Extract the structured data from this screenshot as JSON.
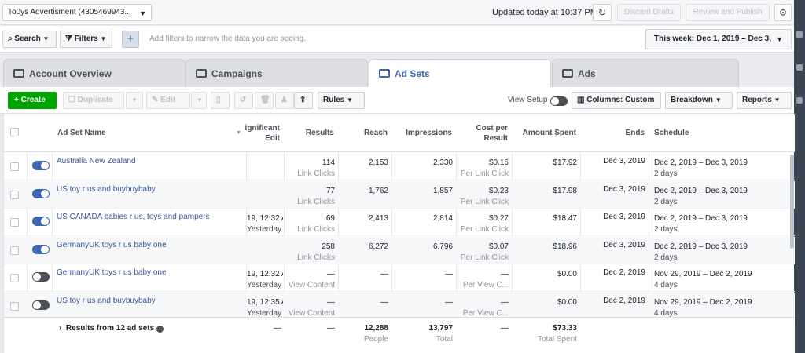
{
  "topbar": {
    "account": "To0ys Advertisment (4305469943...",
    "updated": "Updated today at 10:37 PM",
    "discard": "Discard Drafts",
    "review": "Review and Publish"
  },
  "filterbar": {
    "search": "Search",
    "filters": "Filters",
    "hint": "Add filters to narrow the data you are seeing.",
    "date": "This week: Dec 1, 2019 – Dec 3,"
  },
  "tabs": [
    {
      "label": "Account Overview"
    },
    {
      "label": "Campaigns"
    },
    {
      "label": "Ad Sets"
    },
    {
      "label": "Ads"
    }
  ],
  "toolbar": {
    "create": "Create",
    "duplicate": "Duplicate",
    "edit": "Edit",
    "rules": "Rules",
    "view_setup": "View Setup",
    "columns": "Columns: Custom",
    "breakdown": "Breakdown",
    "reports": "Reports"
  },
  "table": {
    "headers": {
      "name": "Ad Set Name",
      "edit": "ignificant Edit",
      "results": "Results",
      "reach": "Reach",
      "impressions": "Impressions",
      "cost": "Cost per Result",
      "amount": "Amount Spent",
      "ends": "Ends",
      "schedule": "Schedule"
    },
    "rows": [
      {
        "name": "Australia New Zealand",
        "edit1": "",
        "edit2": "",
        "results": "114",
        "results_sub": "Link Clicks",
        "reach": "2,153",
        "impressions": "2,330",
        "cost": "$0.16",
        "cost_sub": "Per Link Click",
        "amount": "$17.92",
        "ends": "Dec 3, 2019",
        "schedule": "Dec 2, 2019 – Dec 3, 2019",
        "schedule_sub": "2 days"
      },
      {
        "name": "US toy r us and buybuybaby",
        "edit1": "",
        "edit2": "",
        "results": "77",
        "results_sub": "Link Clicks",
        "reach": "1,762",
        "impressions": "1,857",
        "cost": "$0.23",
        "cost_sub": "Per Link Click",
        "amount": "$17.98",
        "ends": "Dec 3, 2019",
        "schedule": "Dec 2, 2019 – Dec 3, 2019",
        "schedule_sub": "2 days"
      },
      {
        "name": "US CANADA babies r us, toys and pampers",
        "edit1": "19, 12:32 A",
        "edit2": "Yesterday",
        "results": "69",
        "results_sub": "Link Clicks",
        "reach": "2,413",
        "impressions": "2,814",
        "cost": "$0.27",
        "cost_sub": "Per Link Click",
        "amount": "$18.47",
        "ends": "Dec 3, 2019",
        "schedule": "Dec 2, 2019 – Dec 3, 2019",
        "schedule_sub": "2 days"
      },
      {
        "name": "GermanyUK toys r us baby one",
        "edit1": "",
        "edit2": "",
        "results": "258",
        "results_sub": "Link Clicks",
        "reach": "6,272",
        "impressions": "6,796",
        "cost": "$0.07",
        "cost_sub": "Per Link Click",
        "amount": "$18.96",
        "ends": "Dec 3, 2019",
        "schedule": "Dec 2, 2019 – Dec 3, 2019",
        "schedule_sub": "2 days"
      },
      {
        "name": "GermanyUK toys r us baby one",
        "edit1": "19, 12:32 A",
        "edit2": "Yesterday",
        "results": "—",
        "results_sub": "View Content",
        "reach": "—",
        "impressions": "—",
        "cost": "—",
        "cost_sub": "Per View C...",
        "amount": "$0.00",
        "ends": "Dec 2, 2019",
        "schedule": "Nov 29, 2019 – Dec 2, 2019",
        "schedule_sub": "4 days"
      },
      {
        "name": "US toy r us and buybuybaby",
        "edit1": "19, 12:35 A",
        "edit2": "Yesterday",
        "results": "—",
        "results_sub": "View Content",
        "reach": "—",
        "impressions": "—",
        "cost": "—",
        "cost_sub": "Per View C...",
        "amount": "$0.00",
        "ends": "Dec 2, 2019",
        "schedule": "Nov 29, 2019 – Dec 2, 2019",
        "schedule_sub": "4 days"
      }
    ],
    "toggles": [
      true,
      true,
      true,
      true,
      false,
      false
    ],
    "footer": {
      "label": "Results from 12 ad sets",
      "edit": "—",
      "results": "—",
      "reach": "12,288",
      "reach_sub": "People",
      "impressions": "13,797",
      "impressions_sub": "Total",
      "cost": "—",
      "amount": "$73.33",
      "amount_sub": "Total Spent"
    }
  }
}
